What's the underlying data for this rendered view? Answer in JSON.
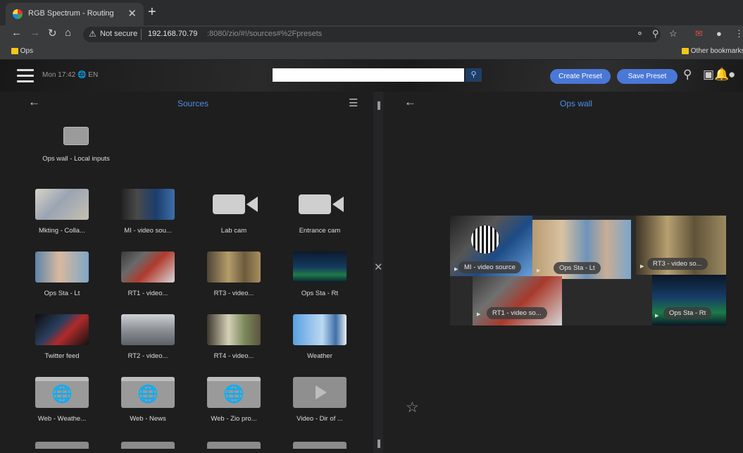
{
  "browser": {
    "tab_title": "RGB Spectrum - Routing",
    "tab_close": "✕",
    "new_tab": "+",
    "security_label": "Not secure",
    "url_host": "192.168.70.79",
    "url_path": ":8080/zio/#!/sources#%2Fpresets",
    "bookmarks": {
      "ops": "Ops",
      "other": "Other bookmarks"
    }
  },
  "app": {
    "clock": "Mon 17:42",
    "locale": "EN",
    "search_placeholder": "",
    "create_preset": "Create Preset",
    "save_preset": "Save Preset"
  },
  "sources_panel": {
    "title": "Sources",
    "local_group": "Ops wall - Local inputs",
    "items": [
      {
        "label": "Mkting - Colla..."
      },
      {
        "label": "MI - video sou..."
      },
      {
        "label": "Lab cam"
      },
      {
        "label": "Entrance cam"
      },
      {
        "label": "Ops Sta - Lt"
      },
      {
        "label": "RT1 - video..."
      },
      {
        "label": "RT3 - video..."
      },
      {
        "label": "Ops Sta - Rt"
      },
      {
        "label": "Twitter feed"
      },
      {
        "label": "RT2 - video..."
      },
      {
        "label": "RT4 - video..."
      },
      {
        "label": "Weather"
      },
      {
        "label": "Web - Weathe..."
      },
      {
        "label": "Web - News"
      },
      {
        "label": "Web - Zio pro..."
      },
      {
        "label": "Video - Dir of ..."
      }
    ]
  },
  "wall_panel": {
    "title": "Ops wall",
    "windows": [
      {
        "label": "MI - video source"
      },
      {
        "label": "Ops Sta - Lt"
      },
      {
        "label": "RT3 - video so..."
      },
      {
        "label": "RT1 - video so..."
      },
      {
        "label": "Ops Sta - Rt"
      }
    ]
  },
  "colors": {
    "accent": "#4a78d6",
    "title_blue": "#4f8ee6"
  }
}
